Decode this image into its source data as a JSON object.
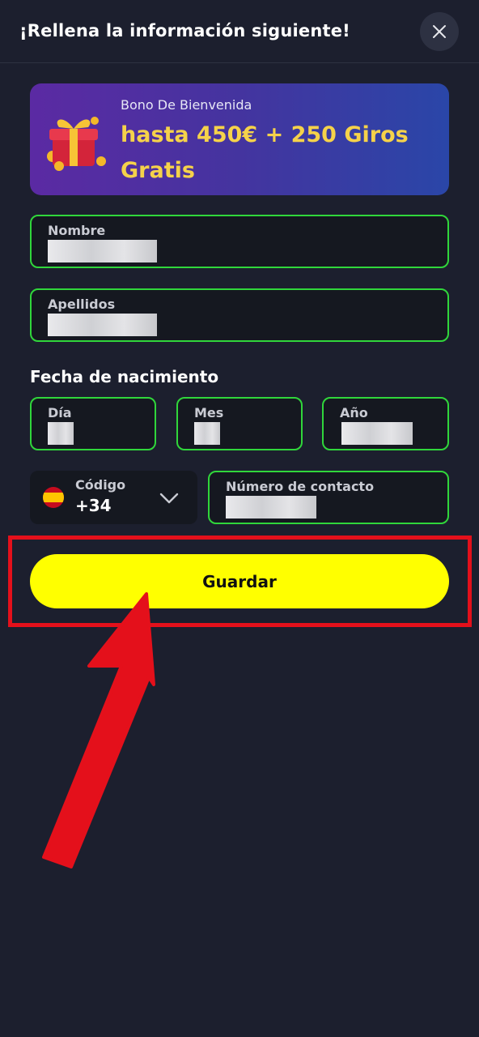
{
  "header": {
    "title": "¡Rellena la información siguiente!",
    "close_icon": "close-icon"
  },
  "bonus": {
    "label": "Bono De Bienvenida",
    "amount": "hasta 450€ + 250 Giros Gratis",
    "icon": "gift-icon",
    "colors": {
      "amount": "#f5d24a",
      "gradient_start": "#5b2aa3",
      "gradient_end": "#2a46a8"
    }
  },
  "form": {
    "first_name": {
      "label": "Nombre",
      "value": ""
    },
    "last_name": {
      "label": "Apellidos",
      "value": ""
    },
    "birth_date": {
      "title": "Fecha de nacimiento",
      "day": {
        "label": "Día",
        "value": ""
      },
      "month": {
        "label": "Mes",
        "value": ""
      },
      "year": {
        "label": "Año",
        "value": ""
      }
    },
    "phone_code": {
      "label": "Código",
      "value": "+34",
      "flag": "spain-flag-icon",
      "chevron": "chevron-down-icon"
    },
    "phone_number": {
      "label": "Número de contacto",
      "value": ""
    },
    "field_border_color": "#30d63b"
  },
  "actions": {
    "save_label": "Guardar",
    "save_color": "#ffff00"
  },
  "annotations": {
    "highlight_color": "#e4101b",
    "arrow_color": "#e4101b"
  }
}
